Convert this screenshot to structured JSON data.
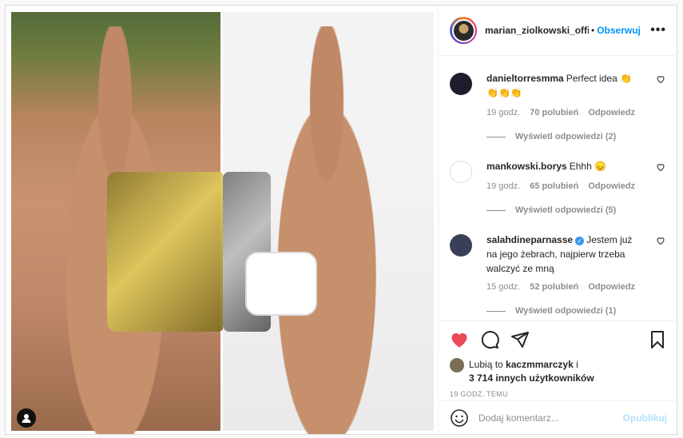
{
  "header": {
    "username": "marian_ziolkowski_offi",
    "separator": "•",
    "follow_label": "Obserwuj",
    "more_label": "•••"
  },
  "comments": [
    {
      "user": "danieltorresmma",
      "text": "Perfect idea 👏👏👏👏",
      "verified": false,
      "time": "19 godz.",
      "likes": "70 polubień",
      "reply": "Odpowiedz",
      "view_replies": "Wyświetl odpowiedzi (2)"
    },
    {
      "user": "mankowski.borys",
      "text": "Ehhh 😞",
      "verified": false,
      "time": "19 godz.",
      "likes": "65 polubień",
      "reply": "Odpowiedz",
      "view_replies": "Wyświetl odpowiedzi (5)"
    },
    {
      "user": "salahdineparnasse",
      "text": "Jestem już na jego żebrach, najpierw trzeba walczyć ze mną",
      "verified": true,
      "time": "15 godz.",
      "likes": "52 polubień",
      "reply": "Odpowiedz",
      "view_replies": "Wyświetl odpowiedzi (1)"
    }
  ],
  "likes": {
    "prefix": "Lubią to",
    "user": "kaczmmarczyk",
    "suffix": "i",
    "others": "3 714 innych użytkowników"
  },
  "post_time": "19 GODZ. TEMU",
  "add_comment": {
    "placeholder": "Dodaj komentarz...",
    "post_label": "Opublikuj"
  },
  "colors": {
    "accent": "#0095f6",
    "like_red": "#ed4956",
    "post_disabled": "#b2dffc"
  },
  "icons": [
    "heart-icon",
    "comment-icon",
    "share-icon",
    "bookmark-icon",
    "emoji-icon",
    "user-tag-icon"
  ]
}
